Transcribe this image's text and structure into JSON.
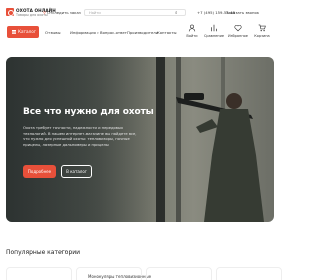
{
  "brand": {
    "name": "ОХОТА ОНЛАЙН",
    "tagline": "Товары для охоты"
  },
  "header": {
    "track_label": "Отследить заказ",
    "search_placeholder": "Найти",
    "phone": "+7 (495) 159-55-48",
    "callback_label": "Заказать звонок"
  },
  "nav": {
    "catalog_label": "Каталог",
    "items": [
      "Отзывы",
      "Информация",
      "Вопрос-ответ",
      "Производители",
      "Контакты"
    ],
    "actions": [
      {
        "label": "Войти",
        "icon": "user-icon"
      },
      {
        "label": "Сравнение",
        "icon": "compare-icon"
      },
      {
        "label": "Избранное",
        "icon": "heart-icon"
      },
      {
        "label": "Корзина",
        "icon": "cart-icon"
      }
    ]
  },
  "hero": {
    "title": "Все что нужно для охоты",
    "text": "Охота требует точности, надежности и передовых технологий. В нашем интернет-магазине вы найдете все, что нужно для успешной охоты: тепловизоры, ночные прицелы, лазерные дальномеры и прицелы",
    "primary_button": "Подробнее",
    "secondary_button": "В каталог"
  },
  "categories": {
    "title": "Популярные категории",
    "cards": [
      "Монокуляры тепловизионные"
    ]
  },
  "colors": {
    "accent": "#e8503a"
  }
}
